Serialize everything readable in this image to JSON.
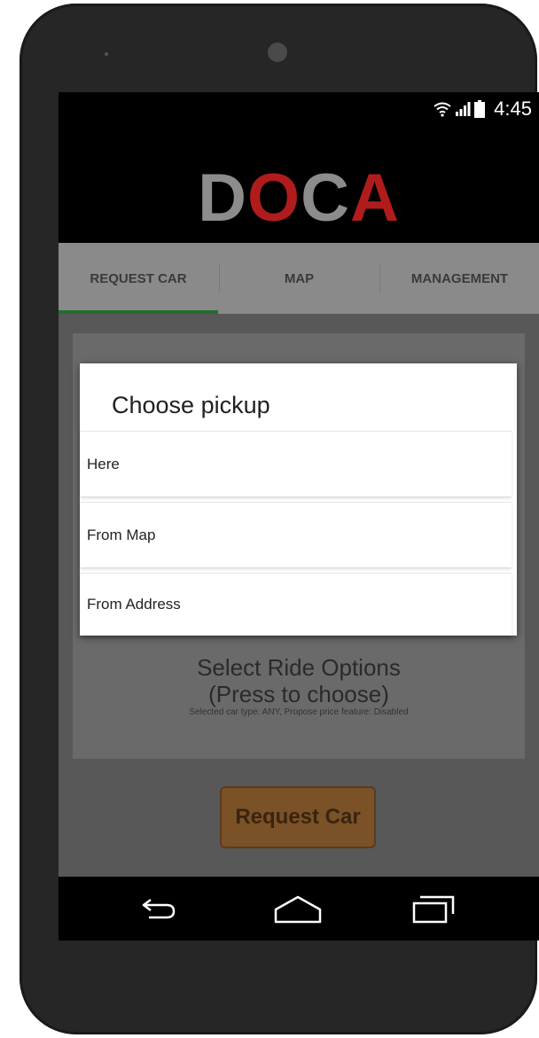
{
  "status_bar": {
    "time": "4:45"
  },
  "app": {
    "logo_letters": [
      {
        "char": "D",
        "color": "#8c8c8c"
      },
      {
        "char": "O",
        "color": "#b01c1c"
      },
      {
        "char": "C",
        "color": "#8c8c8c"
      },
      {
        "char": "A",
        "color": "#b01c1c"
      }
    ]
  },
  "tabs": [
    {
      "label": "REQUEST CAR",
      "active": true
    },
    {
      "label": "MAP",
      "active": false
    },
    {
      "label": "MANAGEMENT",
      "active": false
    }
  ],
  "ride_options": {
    "title_line1": "Select Ride Options",
    "title_line2": "(Press to choose)",
    "subtitle": "Selected car type: ANY, Propose price feature: Disabled"
  },
  "request_button": {
    "label": "Request Car"
  },
  "dialog": {
    "title": "Choose pickup",
    "options": [
      "Here",
      "From Map",
      "From Address"
    ]
  },
  "colors": {
    "accent": "#1f6e2b",
    "logo_red": "#b01c1c",
    "logo_gray": "#8c8c8c"
  }
}
